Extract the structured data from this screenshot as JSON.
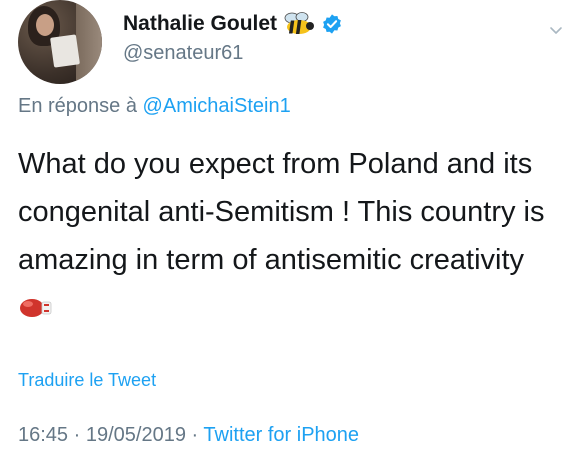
{
  "author": {
    "name": "Nathalie Goulet",
    "handle": "@senateur61",
    "name_emoji": "bee-icon",
    "verified": true
  },
  "reply": {
    "prefix": "En réponse à",
    "mention": "@AmichaiStein1"
  },
  "tweet": {
    "text": "What do you expect from Poland and its congenital anti-Semitism ! This country is amazing in term of antisemitic creativity",
    "trailing_emoji": "boxing-glove-icon"
  },
  "actions": {
    "translate_label": "Traduire le Tweet"
  },
  "meta": {
    "time": "16:45",
    "date": "19/05/2019",
    "separator": "·",
    "source": "Twitter for iPhone"
  },
  "colors": {
    "text": "#14171a",
    "secondary": "#657786",
    "accent": "#1da1f2"
  }
}
